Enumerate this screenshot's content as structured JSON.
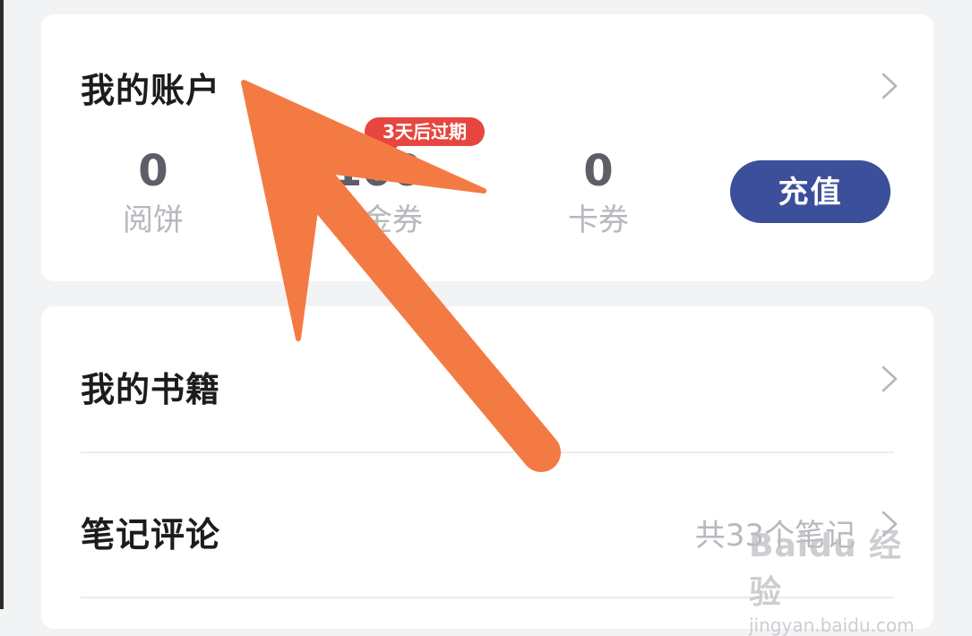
{
  "colors": {
    "page_bg": "#f2f3f5",
    "card_bg": "#ffffff",
    "accent_button": "#3b4f9a",
    "badge_red": "#e6463f",
    "arrow_orange": "#f47a44"
  },
  "account": {
    "title": "我的账户",
    "stats": [
      {
        "value": "0",
        "label": "阅饼"
      },
      {
        "value": "100",
        "label": "代金券"
      },
      {
        "value": "0",
        "label": "卡券"
      }
    ],
    "expiry_badge": "3天后过期",
    "recharge_label": "充值"
  },
  "menu": {
    "items": [
      {
        "label": "我的书籍",
        "meta": ""
      },
      {
        "label": "笔记评论",
        "meta": "共33个笔记"
      }
    ]
  },
  "watermark": {
    "logo": "Baidu 经验",
    "url": "jingyan.baidu.com"
  },
  "icons": {
    "chevron": "chevron-right-icon",
    "annotation": "arrow-annotation-icon"
  }
}
